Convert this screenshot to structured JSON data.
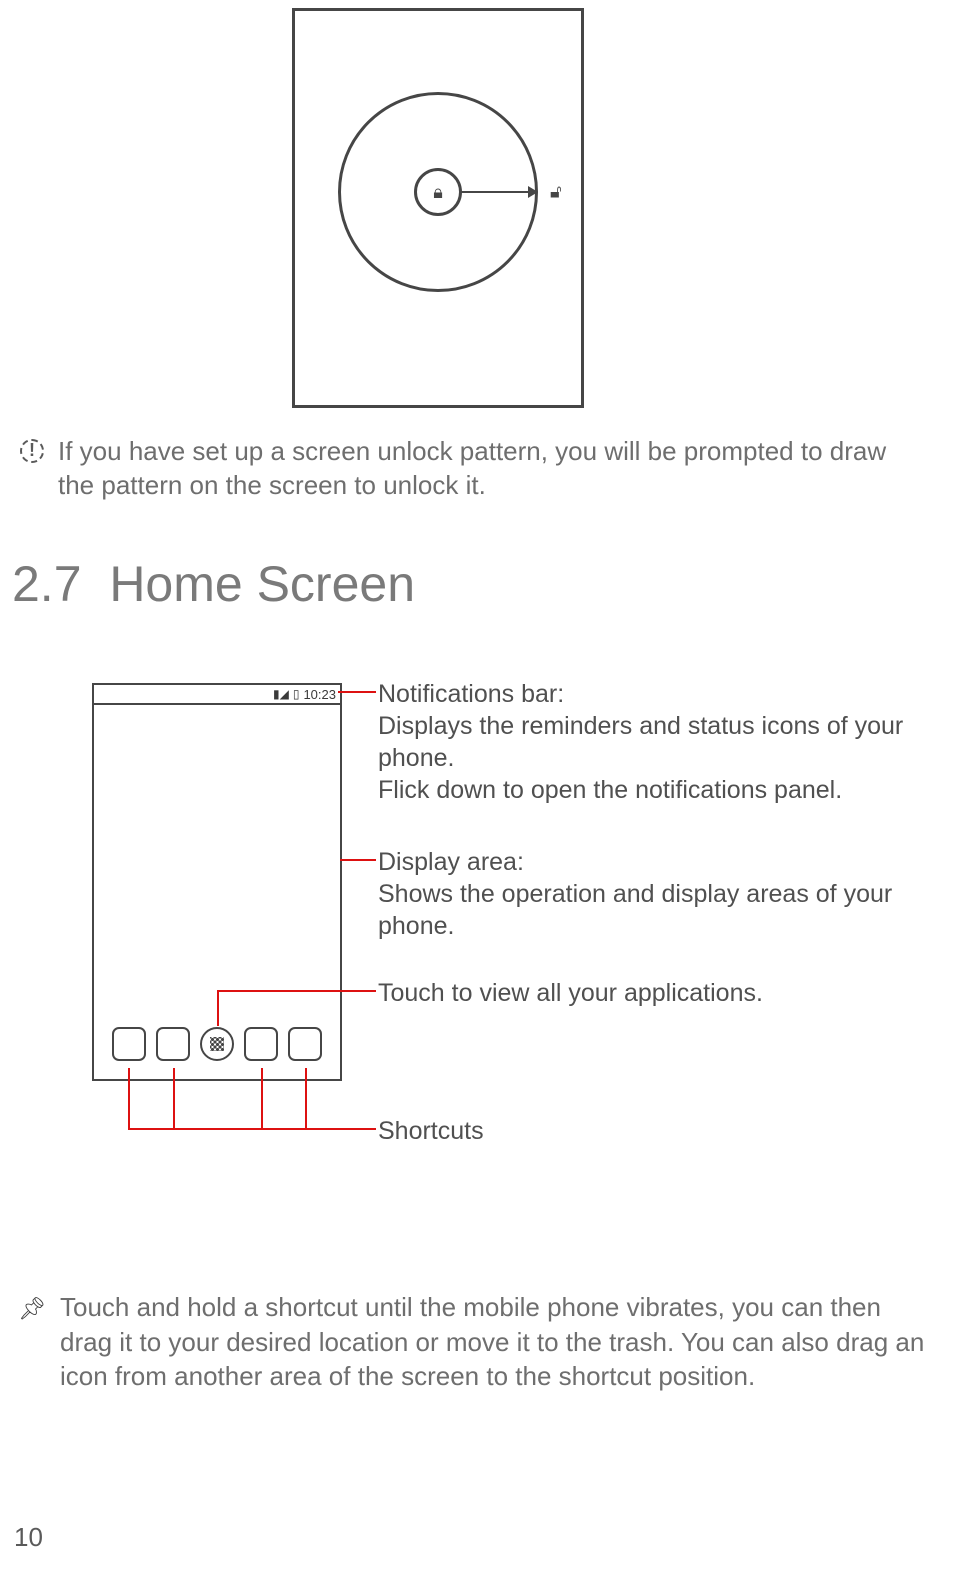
{
  "fig1": {
    "center_icon_name": "lock-icon",
    "target_icon_name": "unlock-icon"
  },
  "note_unlock_pattern": "If you have set up a screen unlock pattern, you will be prompted to draw the pattern on the screen to unlock it.",
  "section": {
    "number": "2.7",
    "title": "Home Screen"
  },
  "fig2": {
    "status_time": "10:23",
    "callouts": {
      "notif_title": "Notifications bar:",
      "notif_body1": "Displays the reminders and status icons of your phone.",
      "notif_body2": "Flick down to open the notifications panel.",
      "display_title": "Display area:",
      "display_body": "Shows the operation and display areas of your phone.",
      "apps_body": "Touch to view all your applications.",
      "shortcuts_title": "Shortcuts"
    }
  },
  "tip_shortcut": "Touch and hold a shortcut until the mobile phone vibrates, you can then drag it to your desired location or move it to the trash. You can also drag an icon from another area of the screen to the shortcut position.",
  "page_number": "10"
}
